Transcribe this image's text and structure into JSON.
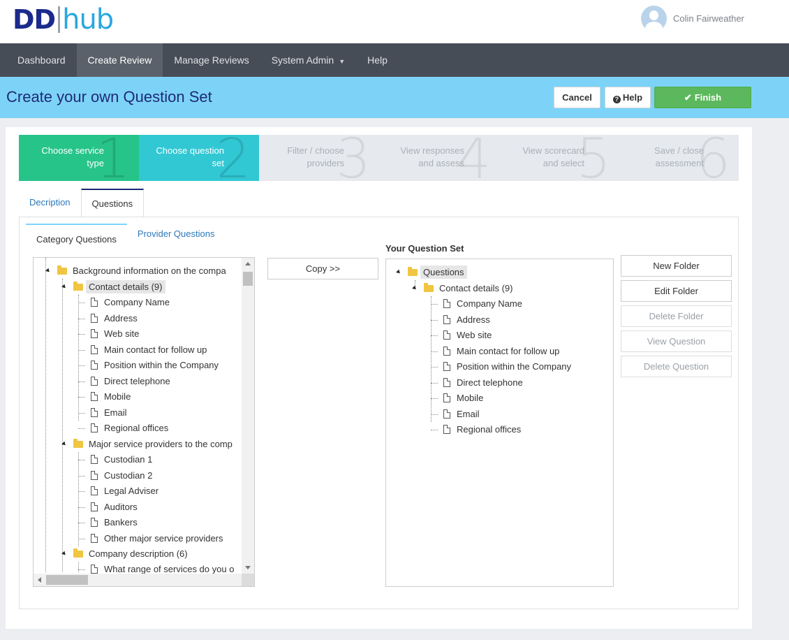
{
  "header": {
    "logo_left": "DD",
    "logo_right": "hub",
    "user_name": "Colin Fairweather"
  },
  "nav": {
    "items": [
      "Dashboard",
      "Create Review",
      "Manage Reviews",
      "System Admin",
      "Help"
    ],
    "active": "Create Review"
  },
  "titlebar": {
    "title": "Create your own Question Set",
    "cancel": "Cancel",
    "help": "Help",
    "finish": "Finish"
  },
  "steps": [
    {
      "line1": "Choose service",
      "line2": "type",
      "num": "1"
    },
    {
      "line1": "Choose question",
      "line2": "set",
      "num": "2"
    },
    {
      "line1": "Filter / choose",
      "line2": "providers",
      "num": "3"
    },
    {
      "line1": "View responses",
      "line2": "and assess",
      "num": "4"
    },
    {
      "line1": "View scorecard",
      "line2": "and select",
      "num": "5"
    },
    {
      "line1": "Save / close",
      "line2": "assessment",
      "num": "6"
    }
  ],
  "tabs": [
    "Decription",
    "Questions"
  ],
  "subtabs": [
    "Category Questions",
    "Provider Questions"
  ],
  "left_tree": {
    "root": "Background information on the compa",
    "contact_folder": "Contact details (9)",
    "contact_items": [
      "Company Name",
      "Address",
      "Web site",
      "Main contact for follow up",
      "Position within the Company",
      "Direct telephone",
      "Mobile",
      "Email",
      "Regional offices"
    ],
    "major_folder": "Major service providers to the comp",
    "major_items": [
      "Custodian 1",
      "Custodian 2",
      "Legal Adviser",
      "Auditors",
      "Bankers",
      "Other major service providers"
    ],
    "company_folder": "Company description (6)",
    "company_first_item": "What range of services do you o"
  },
  "copy_button": "Copy >>",
  "question_set": {
    "title": "Your Question Set",
    "root": "Questions",
    "folder": "Contact details (9)",
    "items": [
      "Company Name",
      "Address",
      "Web site",
      "Main contact for follow up",
      "Position within the Company",
      "Direct telephone",
      "Mobile",
      "Email",
      "Regional offices"
    ]
  },
  "side_buttons": {
    "new_folder": "New Folder",
    "edit_folder": "Edit Folder",
    "delete_folder": "Delete Folder",
    "view_question": "View Question",
    "delete_question": "Delete Question"
  }
}
